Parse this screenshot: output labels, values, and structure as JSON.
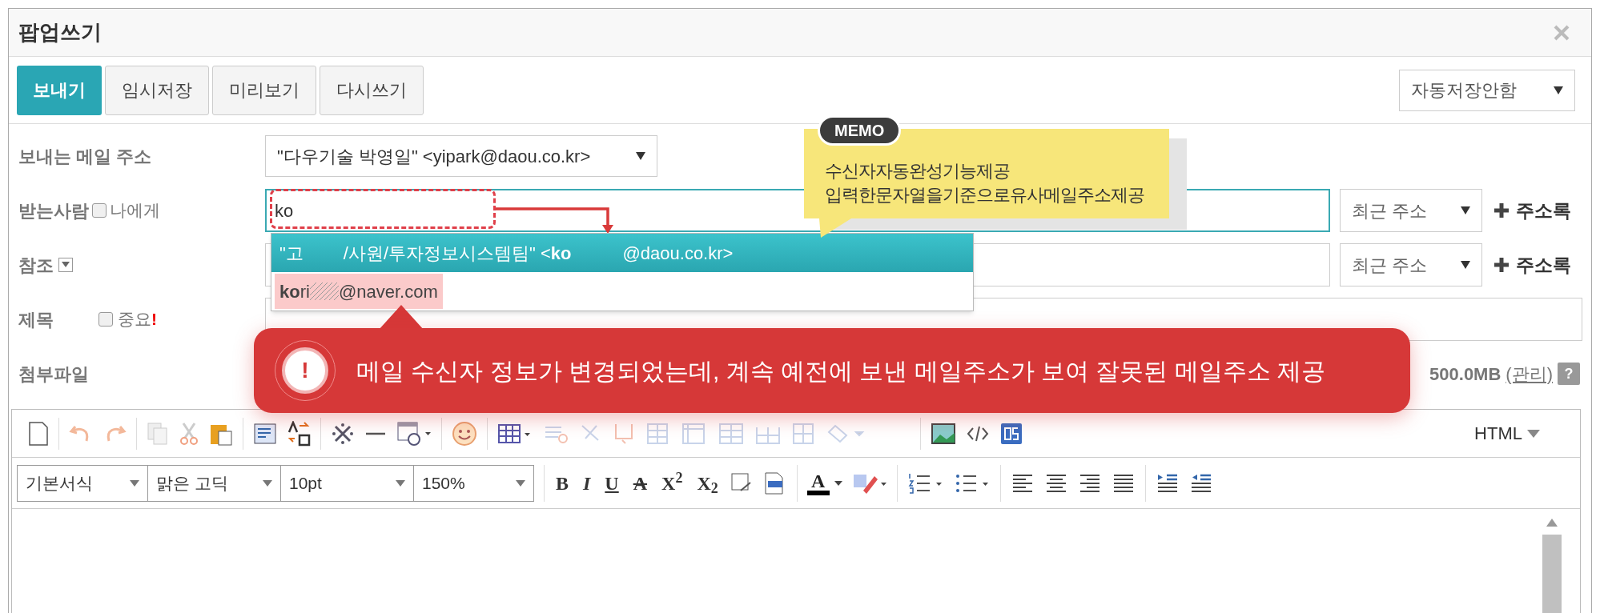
{
  "window": {
    "title": "팝업쓰기"
  },
  "actions": [
    {
      "label": "보내기",
      "kind": "primary"
    },
    {
      "label": "임시저장",
      "kind": "default"
    },
    {
      "label": "미리보기",
      "kind": "default"
    },
    {
      "label": "다시쓰기",
      "kind": "default"
    }
  ],
  "autosave": {
    "value": "자동저장안함"
  },
  "sender": {
    "label": "보내는 메일 주소",
    "value": "\"다우기술 박영일\" <yipark@daou.co.kr>"
  },
  "to": {
    "label": "받는사람",
    "self_label": "나에게",
    "self_checked": false,
    "value": "ko",
    "recent": "최근 주소",
    "address_book": "주소록"
  },
  "cc": {
    "label": "참조",
    "expanded": false,
    "recent": "최근 주소",
    "address_book": "주소록"
  },
  "subject": {
    "label": "제목",
    "important_label": "중요",
    "important_mark": "!",
    "important_checked": false
  },
  "attachment": {
    "label": "첨부파일",
    "quota": "500.0MB",
    "manage": "(관리)",
    "help": "?"
  },
  "suggestions": [
    {
      "selected": true,
      "kind": "blank",
      "segments": [
        "\"고",
        "/사원/투자정보시스템팀\" <**ko**",
        "@daou.co.kr>"
      ]
    },
    {
      "selected": false,
      "kind": "hatch",
      "highlighted": true,
      "segments": [
        "**ko**ri",
        "@naver.com"
      ]
    }
  ],
  "memo": {
    "badge": "MEMO",
    "lines": [
      "수신자자동완성기능제공",
      "입력한문자열을기준으로유사메일주소제공"
    ]
  },
  "callout": {
    "icon": "!",
    "text": "메일 수신자 정보가 변경되었는데, 계속 예전에 보낸 메일주소가 보여 잘못된 메일주소 제공"
  },
  "editor": {
    "mode": "HTML",
    "selects": [
      "기본서식",
      "맑은 고딕",
      "10pt",
      "150%"
    ],
    "format_buttons": [
      {
        "label": "B",
        "kind": "bold"
      },
      {
        "label": "I",
        "kind": "italic"
      },
      {
        "label": "U",
        "kind": "underline"
      },
      {
        "label": "A",
        "kind": "strike"
      },
      {
        "label": "X$^{2}$",
        "kind": "sup"
      },
      {
        "label": "X$_{2}$",
        "kind": "sub"
      }
    ],
    "font_color_label": "A"
  }
}
